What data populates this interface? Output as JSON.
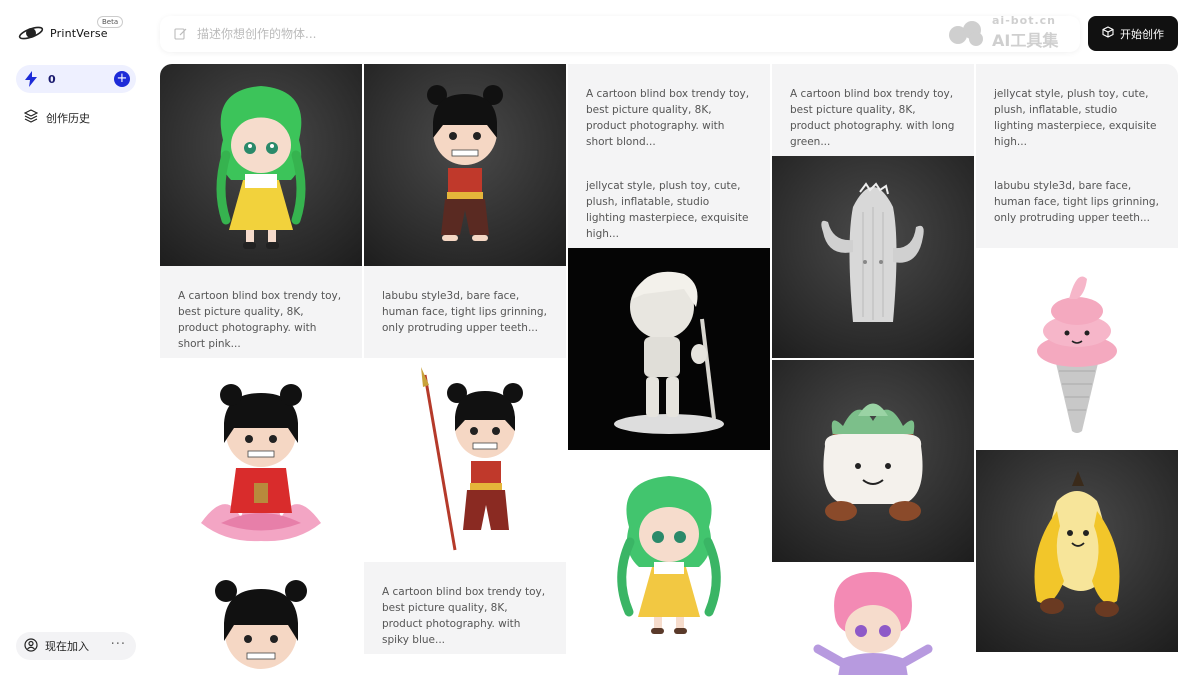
{
  "brand": {
    "name": "PrintVerse",
    "badge": "Beta"
  },
  "sidebar": {
    "credits": "0",
    "history_label": "创作历史",
    "join_label": "现在加入",
    "more_label": "···"
  },
  "topbar": {
    "search_placeholder": "描述你想创作的物体...",
    "start_label": "开始创作",
    "watermark_top": "ai-bot.cn",
    "watermark_bottom": "AI工具集"
  },
  "colors": {
    "accent": "#1d2bd8",
    "button_dark": "#111111",
    "card_text_bg": "#f4f4f5"
  },
  "gallery": {
    "prompts": {
      "c1": "A cartoon blind box trendy toy, best picture quality, 8K, product photography. with short pink...",
      "c2a": "labubu style3d, bare face, human face, tight lips grinning, only protruding upper teeth...",
      "c2b": "A cartoon blind box trendy toy, best picture quality, 8K, product photography. with spiky blue...",
      "c3a": "A cartoon blind box trendy toy, best picture quality, 8K, product photography. with short blond...",
      "c3b": "jellycat style, plush toy, cute, plush, inflatable, studio lighting masterpiece, exquisite high...",
      "c4a": "A cartoon blind box trendy toy, best picture quality, 8K, product photography. with long green...",
      "c5a": "jellycat style, plush toy, cute, plush, inflatable, studio lighting masterpiece, exquisite high...",
      "c5b": "labubu style3d, bare face, human face, tight lips grinning, only protruding upper teeth..."
    },
    "images": [
      "green-hair-girl-toy",
      "nezha-toy-dark",
      "nezha-lotus-toy",
      "white-boy-statue",
      "green-hair-girl-toy-white",
      "nezha-spear-toy",
      "cactus-plush",
      "succulent-pot-plush",
      "pink-hair-boy-toy",
      "ice-cream-plush",
      "banana-plush"
    ]
  }
}
